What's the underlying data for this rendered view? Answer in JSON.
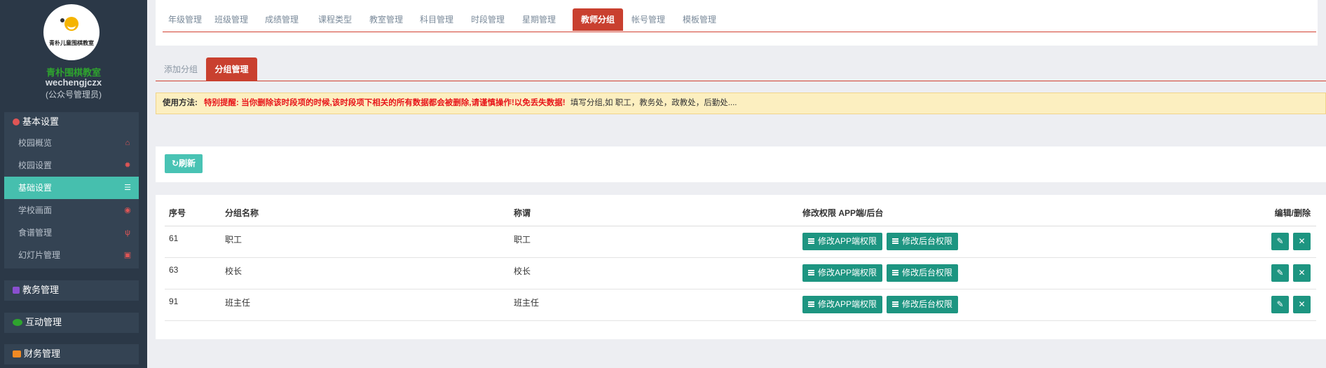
{
  "sidebar": {
    "logo_text": "青朴儿童围棋教室",
    "school_name": "青朴围棋教室",
    "account": "wechengjczx",
    "role": "(公众号管理员)",
    "groups": [
      {
        "title": "基本设置",
        "icon": "gear-icon",
        "color": "#e05555",
        "items": [
          {
            "label": "校园概览",
            "icon": "bank-icon",
            "glyph": "🏛"
          },
          {
            "label": "校园设置",
            "icon": "gear-icon",
            "glyph": "✹"
          },
          {
            "label": "基础设置",
            "icon": "list-icon",
            "glyph": "☰",
            "active": true
          },
          {
            "label": "学校画面",
            "icon": "eye-icon",
            "glyph": "◉"
          },
          {
            "label": "食谱管理",
            "icon": "cutlery-icon",
            "glyph": "🍴"
          },
          {
            "label": "幻灯片管理",
            "icon": "image-icon",
            "glyph": "▣"
          }
        ]
      },
      {
        "title": "教务管理",
        "icon": "book-icon",
        "color": "#8a4fd0"
      },
      {
        "title": "互动管理",
        "icon": "wechat-icon",
        "color": "#2ea42e"
      },
      {
        "title": "财务管理",
        "icon": "money-icon",
        "color": "#f08a24"
      }
    ]
  },
  "topnav": {
    "tabs": [
      "年级管理",
      "班级管理",
      "成绩管理",
      "课程类型",
      "教室管理",
      "科目管理",
      "时段管理",
      "星期管理",
      "教师分组",
      "帐号管理",
      "模板管理"
    ],
    "active_tab": "教师分组"
  },
  "subtabs": [
    "添加分组",
    "分组管理"
  ],
  "notice": {
    "label": "使用方法:",
    "warning": "特别提醒: 当你删除该时段项的时候,该时段项下相关的所有数据都会被删除,请谨慎操作!以免丢失数据!",
    "tip": "填写分组,如 职工，教务处，政教处，后勤处...."
  },
  "refresh_label": "刷新",
  "table": {
    "headers": [
      "序号",
      "分组名称",
      "称谓",
      "修改权限 APP端/后台",
      "编辑/删除"
    ],
    "rows": [
      {
        "id": "61",
        "name": "职工",
        "title": "职工"
      },
      {
        "id": "63",
        "name": "校长",
        "title": "校长"
      },
      {
        "id": "91",
        "name": "班主任",
        "title": "班主任"
      }
    ],
    "app_perm_label": "修改APP端权限",
    "admin_perm_label": "修改后台权限"
  },
  "colors": {
    "accent_red": "#c9402f",
    "teal": "#1d9581",
    "active_menu": "#46bfae"
  }
}
